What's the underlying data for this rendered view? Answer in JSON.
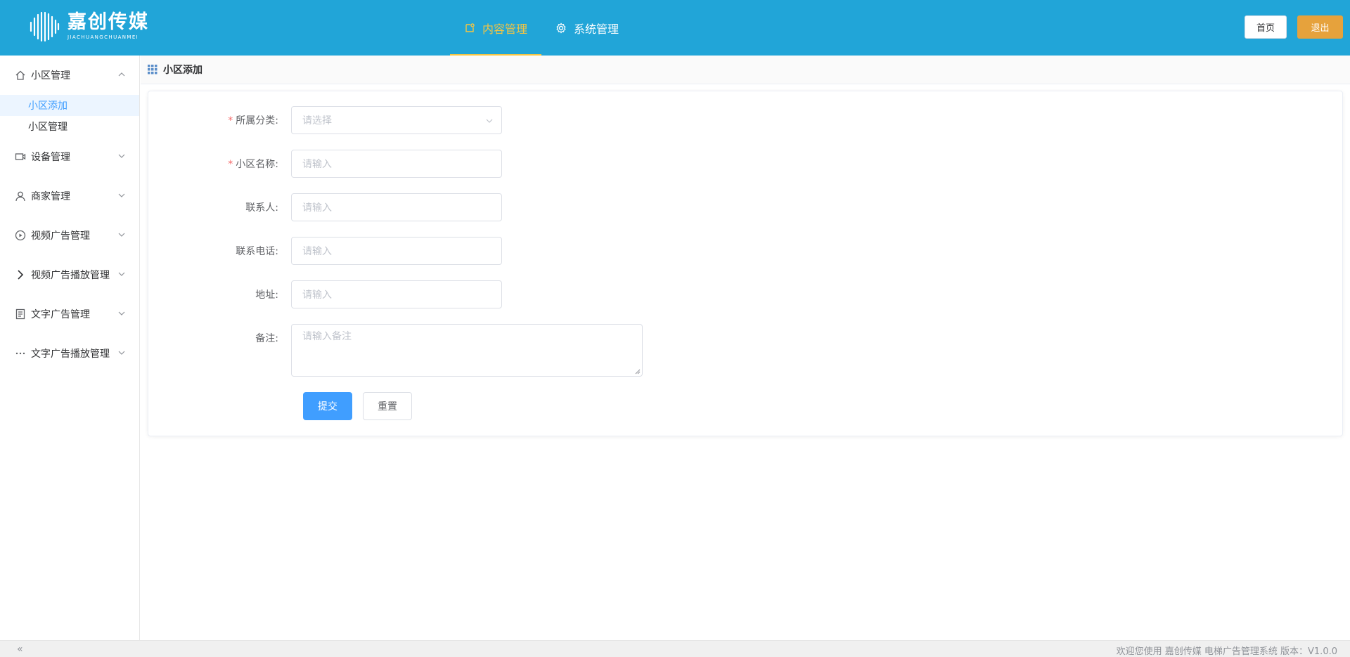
{
  "brand": {
    "name_cn": "嘉创传媒",
    "name_en": "JIACHUANGCHUANMEI"
  },
  "topnav": [
    {
      "label": "内容管理",
      "icon": "content-icon",
      "active": true
    },
    {
      "label": "系统管理",
      "icon": "gear-icon",
      "active": false
    }
  ],
  "header_buttons": {
    "home": "首页",
    "logout": "退出"
  },
  "sidebar": {
    "groups": [
      {
        "label": "小区管理",
        "icon": "home-icon",
        "expanded": true,
        "items": [
          {
            "label": "小区添加",
            "active": true
          },
          {
            "label": "小区管理",
            "active": false
          }
        ]
      },
      {
        "label": "设备管理",
        "icon": "camera-icon",
        "expanded": false
      },
      {
        "label": "商家管理",
        "icon": "user-icon",
        "expanded": false
      },
      {
        "label": "视频广告管理",
        "icon": "play-icon",
        "expanded": false
      },
      {
        "label": "视频广告播放管理",
        "icon": "chevron-right-icon",
        "expanded": false
      },
      {
        "label": "文字广告管理",
        "icon": "document-icon",
        "expanded": false
      },
      {
        "label": "文字广告播放管理",
        "icon": "more-icon",
        "expanded": false
      }
    ]
  },
  "breadcrumb": {
    "title": "小区添加"
  },
  "form": {
    "fields": [
      {
        "label": "所属分类:",
        "required": true,
        "type": "select",
        "placeholder": "请选择"
      },
      {
        "label": "小区名称:",
        "required": true,
        "type": "input",
        "placeholder": "请输入"
      },
      {
        "label": "联系人:",
        "required": false,
        "type": "input",
        "placeholder": "请输入"
      },
      {
        "label": "联系电话:",
        "required": false,
        "type": "input",
        "placeholder": "请输入"
      },
      {
        "label": "地址:",
        "required": false,
        "type": "input",
        "placeholder": "请输入"
      },
      {
        "label": "备注:",
        "required": false,
        "type": "textarea",
        "placeholder": "请输入备注"
      }
    ],
    "submit": "提交",
    "reset": "重置"
  },
  "footer": {
    "collapse_icon": "«",
    "text": "欢迎您使用 嘉创传媒 电梯广告管理系统  版本：V1.0.0"
  },
  "colors": {
    "header_bg": "#21a5d8",
    "active_nav": "#f5c542",
    "primary": "#409eff",
    "warning": "#e6a23c",
    "required": "#f56c6c"
  }
}
